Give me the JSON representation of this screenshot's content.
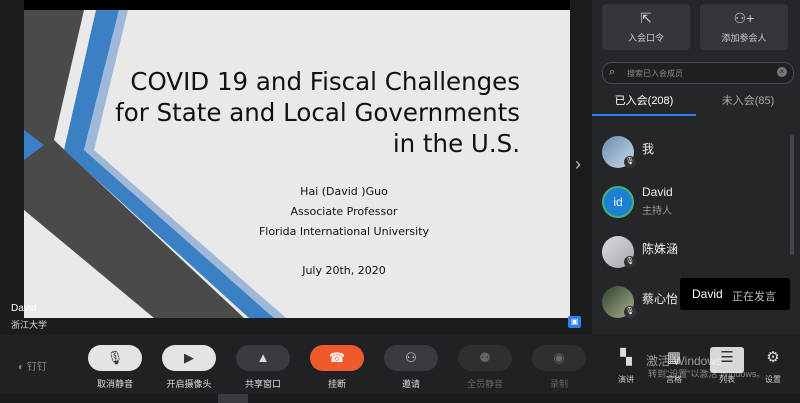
{
  "slide": {
    "title_lines": [
      "COVID 19 and Fiscal Challenges",
      "for State and Local Governments",
      "in the U.S."
    ],
    "author": "Hai (David )Guo",
    "position": "Associate Professor",
    "university": "Florida International University",
    "date": "July 20th, 2020"
  },
  "speaker": {
    "name": "David",
    "org": "浙江大学"
  },
  "sidebar": {
    "top_buttons": [
      {
        "label": "入会口令",
        "icon": "external-link-icon"
      },
      {
        "label": "添加参会人",
        "icon": "add-user-icon"
      }
    ],
    "search_placeholder": "搜索已入会成员",
    "tabs": [
      {
        "label": "已入会(208)"
      },
      {
        "label": "未入会(85)"
      }
    ],
    "members": [
      {
        "name": "我",
        "role": ""
      },
      {
        "name": "David",
        "role": "主持人",
        "avatar_text": "id"
      },
      {
        "name": "陈姝涵",
        "role": ""
      },
      {
        "name": "蔡心怡",
        "role": ""
      }
    ]
  },
  "tooltip": {
    "name": "David",
    "status": "正在发言"
  },
  "toolbar": {
    "brand": "钉钉",
    "buttons": [
      {
        "label": "取消静音",
        "icon": "mic-muted-icon"
      },
      {
        "label": "开启摄像头",
        "icon": "camera-off-icon"
      },
      {
        "label": "共享窗口",
        "icon": "share-screen-icon"
      },
      {
        "label": "挂断",
        "icon": "hang-up-icon"
      },
      {
        "label": "邀请",
        "icon": "invite-icon"
      },
      {
        "label": "全员静音",
        "icon": "mute-all-icon"
      },
      {
        "label": "录制",
        "icon": "record-icon"
      }
    ],
    "right_buttons": [
      {
        "label": "演讲"
      },
      {
        "label": "宫格"
      },
      {
        "label": "列表"
      },
      {
        "label": "设置"
      }
    ],
    "watermark": "激活 Windows",
    "watermark_sub": "转到\"设置\"以激活 Windows。"
  },
  "colors": {
    "accent": "#2e7cf6",
    "hangup": "#f05a2a"
  }
}
